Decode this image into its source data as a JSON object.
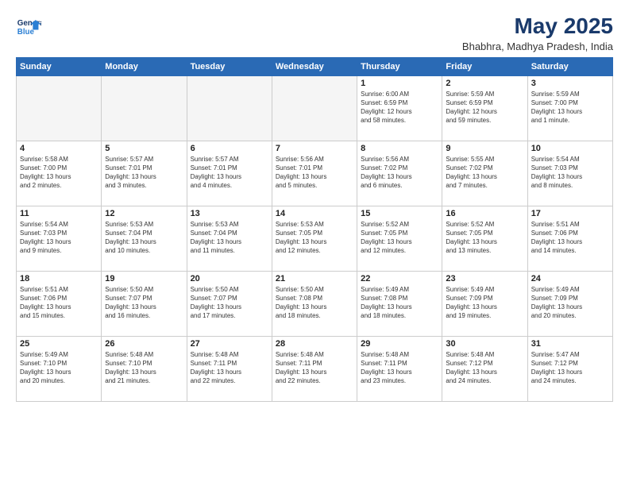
{
  "header": {
    "logo_line1": "General",
    "logo_line2": "Blue",
    "month": "May 2025",
    "location": "Bhabhra, Madhya Pradesh, India"
  },
  "weekdays": [
    "Sunday",
    "Monday",
    "Tuesday",
    "Wednesday",
    "Thursday",
    "Friday",
    "Saturday"
  ],
  "weeks": [
    [
      {
        "day": "",
        "text": "",
        "empty": true
      },
      {
        "day": "",
        "text": "",
        "empty": true
      },
      {
        "day": "",
        "text": "",
        "empty": true
      },
      {
        "day": "",
        "text": "",
        "empty": true
      },
      {
        "day": "1",
        "text": "Sunrise: 6:00 AM\nSunset: 6:59 PM\nDaylight: 12 hours\nand 58 minutes.",
        "empty": false
      },
      {
        "day": "2",
        "text": "Sunrise: 5:59 AM\nSunset: 6:59 PM\nDaylight: 12 hours\nand 59 minutes.",
        "empty": false
      },
      {
        "day": "3",
        "text": "Sunrise: 5:59 AM\nSunset: 7:00 PM\nDaylight: 13 hours\nand 1 minute.",
        "empty": false
      }
    ],
    [
      {
        "day": "4",
        "text": "Sunrise: 5:58 AM\nSunset: 7:00 PM\nDaylight: 13 hours\nand 2 minutes.",
        "empty": false
      },
      {
        "day": "5",
        "text": "Sunrise: 5:57 AM\nSunset: 7:01 PM\nDaylight: 13 hours\nand 3 minutes.",
        "empty": false
      },
      {
        "day": "6",
        "text": "Sunrise: 5:57 AM\nSunset: 7:01 PM\nDaylight: 13 hours\nand 4 minutes.",
        "empty": false
      },
      {
        "day": "7",
        "text": "Sunrise: 5:56 AM\nSunset: 7:01 PM\nDaylight: 13 hours\nand 5 minutes.",
        "empty": false
      },
      {
        "day": "8",
        "text": "Sunrise: 5:56 AM\nSunset: 7:02 PM\nDaylight: 13 hours\nand 6 minutes.",
        "empty": false
      },
      {
        "day": "9",
        "text": "Sunrise: 5:55 AM\nSunset: 7:02 PM\nDaylight: 13 hours\nand 7 minutes.",
        "empty": false
      },
      {
        "day": "10",
        "text": "Sunrise: 5:54 AM\nSunset: 7:03 PM\nDaylight: 13 hours\nand 8 minutes.",
        "empty": false
      }
    ],
    [
      {
        "day": "11",
        "text": "Sunrise: 5:54 AM\nSunset: 7:03 PM\nDaylight: 13 hours\nand 9 minutes.",
        "empty": false
      },
      {
        "day": "12",
        "text": "Sunrise: 5:53 AM\nSunset: 7:04 PM\nDaylight: 13 hours\nand 10 minutes.",
        "empty": false
      },
      {
        "day": "13",
        "text": "Sunrise: 5:53 AM\nSunset: 7:04 PM\nDaylight: 13 hours\nand 11 minutes.",
        "empty": false
      },
      {
        "day": "14",
        "text": "Sunrise: 5:53 AM\nSunset: 7:05 PM\nDaylight: 13 hours\nand 12 minutes.",
        "empty": false
      },
      {
        "day": "15",
        "text": "Sunrise: 5:52 AM\nSunset: 7:05 PM\nDaylight: 13 hours\nand 12 minutes.",
        "empty": false
      },
      {
        "day": "16",
        "text": "Sunrise: 5:52 AM\nSunset: 7:05 PM\nDaylight: 13 hours\nand 13 minutes.",
        "empty": false
      },
      {
        "day": "17",
        "text": "Sunrise: 5:51 AM\nSunset: 7:06 PM\nDaylight: 13 hours\nand 14 minutes.",
        "empty": false
      }
    ],
    [
      {
        "day": "18",
        "text": "Sunrise: 5:51 AM\nSunset: 7:06 PM\nDaylight: 13 hours\nand 15 minutes.",
        "empty": false
      },
      {
        "day": "19",
        "text": "Sunrise: 5:50 AM\nSunset: 7:07 PM\nDaylight: 13 hours\nand 16 minutes.",
        "empty": false
      },
      {
        "day": "20",
        "text": "Sunrise: 5:50 AM\nSunset: 7:07 PM\nDaylight: 13 hours\nand 17 minutes.",
        "empty": false
      },
      {
        "day": "21",
        "text": "Sunrise: 5:50 AM\nSunset: 7:08 PM\nDaylight: 13 hours\nand 18 minutes.",
        "empty": false
      },
      {
        "day": "22",
        "text": "Sunrise: 5:49 AM\nSunset: 7:08 PM\nDaylight: 13 hours\nand 18 minutes.",
        "empty": false
      },
      {
        "day": "23",
        "text": "Sunrise: 5:49 AM\nSunset: 7:09 PM\nDaylight: 13 hours\nand 19 minutes.",
        "empty": false
      },
      {
        "day": "24",
        "text": "Sunrise: 5:49 AM\nSunset: 7:09 PM\nDaylight: 13 hours\nand 20 minutes.",
        "empty": false
      }
    ],
    [
      {
        "day": "25",
        "text": "Sunrise: 5:49 AM\nSunset: 7:10 PM\nDaylight: 13 hours\nand 20 minutes.",
        "empty": false
      },
      {
        "day": "26",
        "text": "Sunrise: 5:48 AM\nSunset: 7:10 PM\nDaylight: 13 hours\nand 21 minutes.",
        "empty": false
      },
      {
        "day": "27",
        "text": "Sunrise: 5:48 AM\nSunset: 7:11 PM\nDaylight: 13 hours\nand 22 minutes.",
        "empty": false
      },
      {
        "day": "28",
        "text": "Sunrise: 5:48 AM\nSunset: 7:11 PM\nDaylight: 13 hours\nand 22 minutes.",
        "empty": false
      },
      {
        "day": "29",
        "text": "Sunrise: 5:48 AM\nSunset: 7:11 PM\nDaylight: 13 hours\nand 23 minutes.",
        "empty": false
      },
      {
        "day": "30",
        "text": "Sunrise: 5:48 AM\nSunset: 7:12 PM\nDaylight: 13 hours\nand 24 minutes.",
        "empty": false
      },
      {
        "day": "31",
        "text": "Sunrise: 5:47 AM\nSunset: 7:12 PM\nDaylight: 13 hours\nand 24 minutes.",
        "empty": false
      }
    ]
  ]
}
